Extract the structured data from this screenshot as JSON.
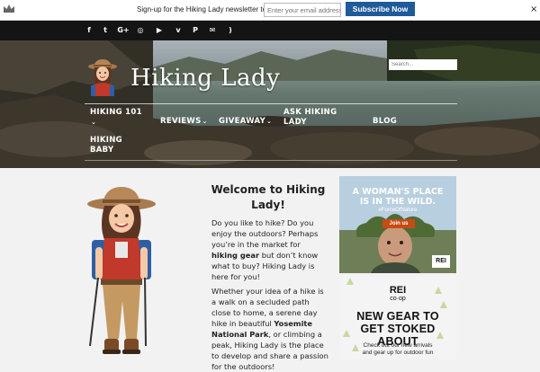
{
  "newsletter": {
    "text": "Sign-up for the Hiking Lady newsletter today!",
    "email_placeholder": "Enter your email address",
    "button_label": "Subscribe Now",
    "close_label": "×"
  },
  "social": {
    "icons": [
      {
        "name": "facebook-icon",
        "glyph": "f"
      },
      {
        "name": "twitter-icon",
        "glyph": "t"
      },
      {
        "name": "google-plus-icon",
        "glyph": "G+"
      },
      {
        "name": "instagram-icon",
        "glyph": "◎"
      },
      {
        "name": "youtube-icon",
        "glyph": "▶"
      },
      {
        "name": "vimeo-icon",
        "glyph": "v"
      },
      {
        "name": "pinterest-icon",
        "glyph": "P"
      },
      {
        "name": "email-icon",
        "glyph": "✉"
      },
      {
        "name": "rss-icon",
        "glyph": ")"
      }
    ]
  },
  "header": {
    "site_title": "Hiking Lady",
    "search_placeholder": "Search..."
  },
  "menu": {
    "hiking101": "HIKING 101",
    "reviews": "REVIEWS",
    "giveaway": "GIVEAWAY",
    "ask_line1": "ASK HIKING",
    "ask_line2": "LADY",
    "blog": "BLOG",
    "baby_line1": "HIKING",
    "baby_line2": "BABY",
    "caret": "⌄"
  },
  "main": {
    "welcome_line1": "Welcome to Hiking",
    "welcome_line2": "Lady!",
    "p1": {
      "t1": "Do you like to hike? Do you enjoy the outdoors? Perhaps you’re in the market for ",
      "b1": "hiking gear",
      "t2": " but don’t know what to buy?  Hiking Lady is here for you!"
    },
    "p2": {
      "t1": "Whether your idea of a hike is a walk on a secluded path close to home, a serene day hike in beautiful ",
      "b1": "Yosemite National Park",
      "t2": ", or climbing a peak, Hiking Lady is the place to develop and share a passion for the outdoors!"
    }
  },
  "ads": {
    "ad1_line1": "A WOMAN'S PLACE",
    "ad1_line2": "IS IN THE WILD.",
    "ad1_tag": "#ForceOfNature",
    "ad1_button": "Join us",
    "ad1_logo": "REI",
    "ad2_logo_top": "REI",
    "ad2_logo_bottom": "co·op",
    "ad2_line1": "NEW GEAR TO",
    "ad2_line2": "GET STOKED ABOUT",
    "ad2_sub1": "Check out our new arrivals",
    "ad2_sub2": "and gear up for outdoor fun"
  },
  "colors": {
    "subscribe_button": "#1f5a9a",
    "social_bar": "#141414",
    "page_bg": "#f2f2f2"
  }
}
